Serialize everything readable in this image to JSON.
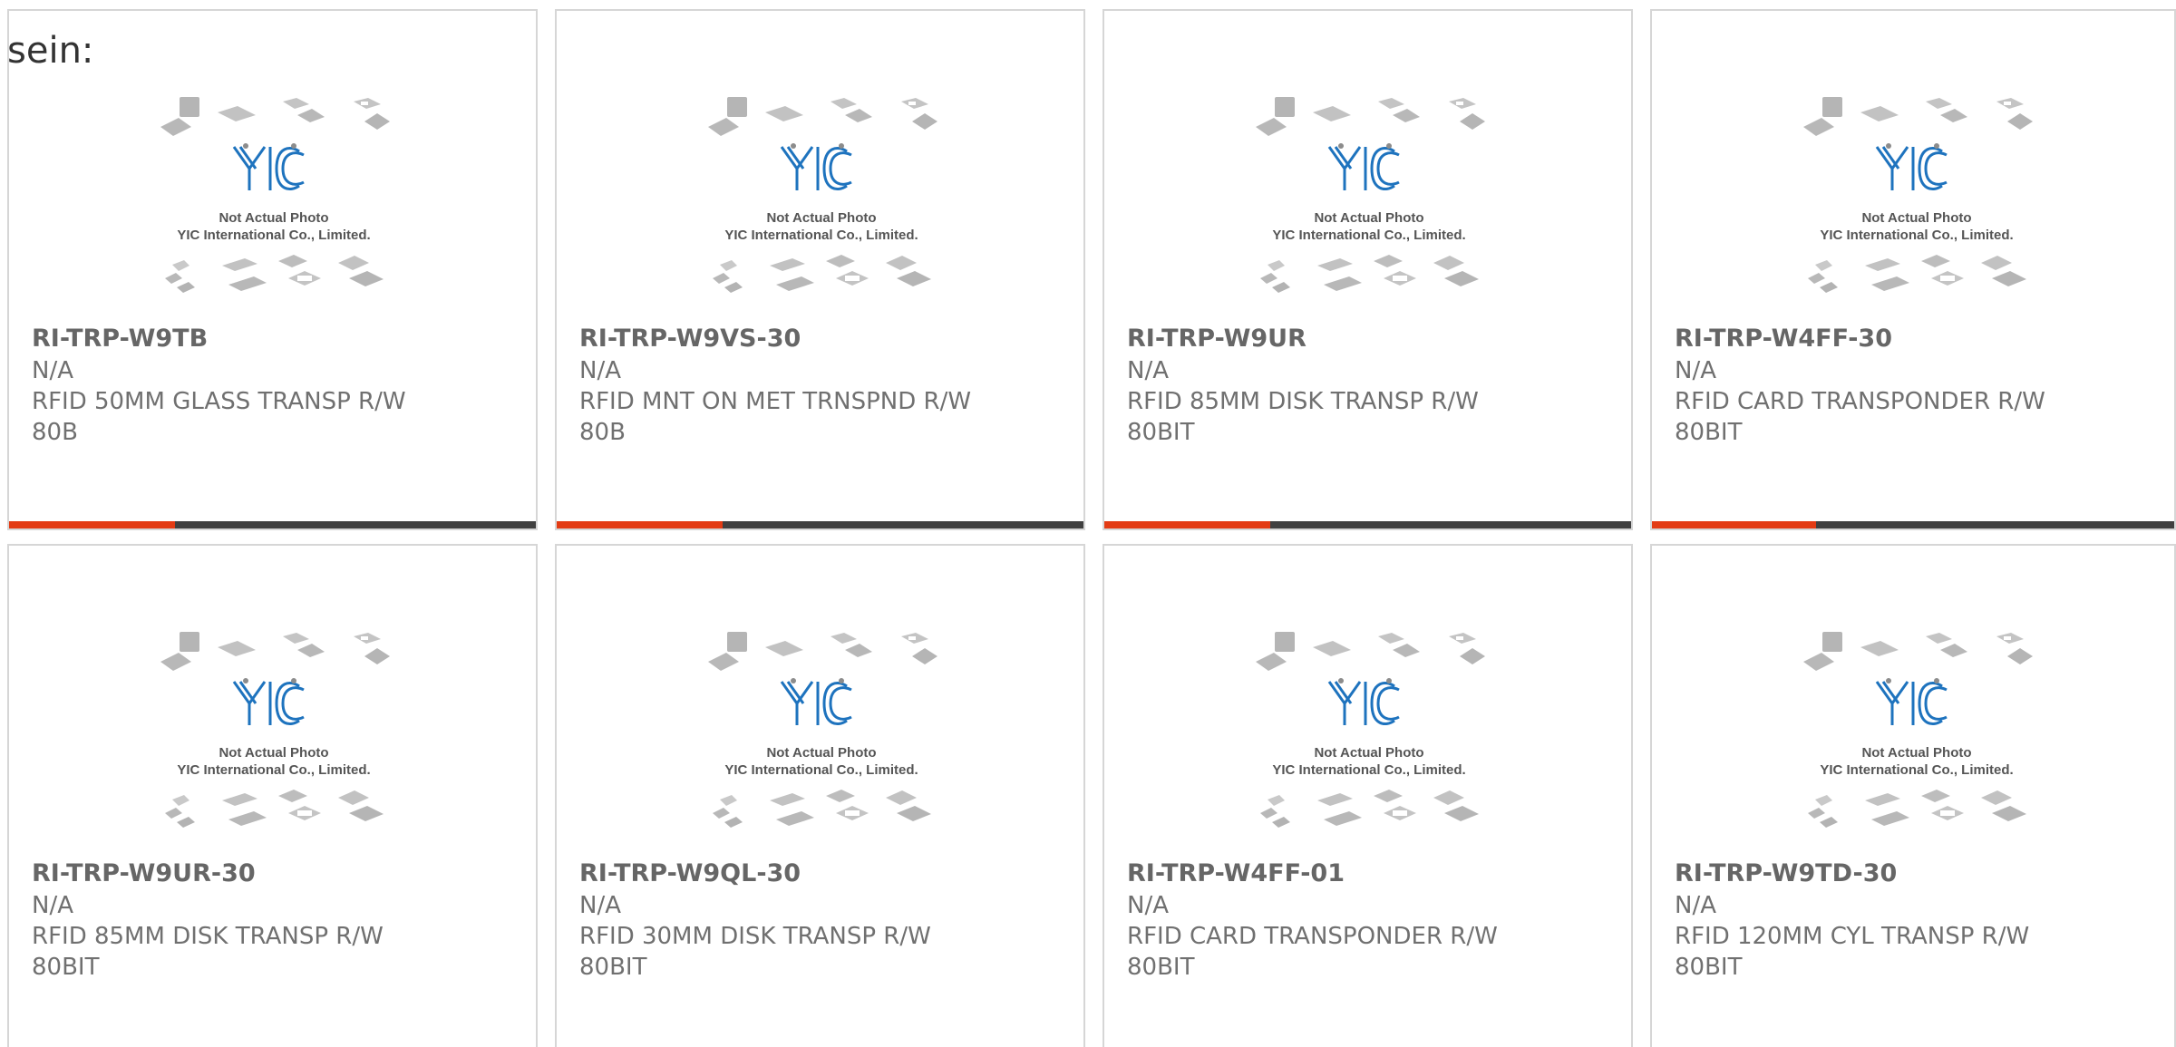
{
  "intro_text": "sein:",
  "image_caption": {
    "line1": "Not Actual Photo",
    "line2": "YIC International Co., Limited.",
    "logo_text": "YIC"
  },
  "colors": {
    "accent_red": "#e33b14",
    "bar_dark": "#404040",
    "logo_blue": "#1e73be",
    "text_gray": "#707070",
    "card_border": "#d6d6d6"
  },
  "products": [
    {
      "part_number": "RI-TRP-W9TB",
      "manufacturer": "N/A",
      "description": "RFID 50MM GLASS TRANSP R/W 80B"
    },
    {
      "part_number": "RI-TRP-W9VS-30",
      "manufacturer": "N/A",
      "description": "RFID MNT ON MET TRNSPND R/W 80B"
    },
    {
      "part_number": "RI-TRP-W9UR",
      "manufacturer": "N/A",
      "description": "RFID 85MM DISK TRANSP R/W 80BIT"
    },
    {
      "part_number": "RI-TRP-W4FF-30",
      "manufacturer": "N/A",
      "description": "RFID CARD TRANSPONDER R/W 80BIT"
    },
    {
      "part_number": "RI-TRP-W9UR-30",
      "manufacturer": "N/A",
      "description": "RFID 85MM DISK TRANSP R/W 80BIT"
    },
    {
      "part_number": "RI-TRP-W9QL-30",
      "manufacturer": "N/A",
      "description": "RFID 30MM DISK TRANSP R/W 80BIT"
    },
    {
      "part_number": "RI-TRP-W4FF-01",
      "manufacturer": "N/A",
      "description": "RFID CARD TRANSPONDER R/W 80BIT"
    },
    {
      "part_number": "RI-TRP-W9TD-30",
      "manufacturer": "N/A",
      "description": "RFID 120MM CYL TRANSP R/W 80BIT"
    }
  ]
}
